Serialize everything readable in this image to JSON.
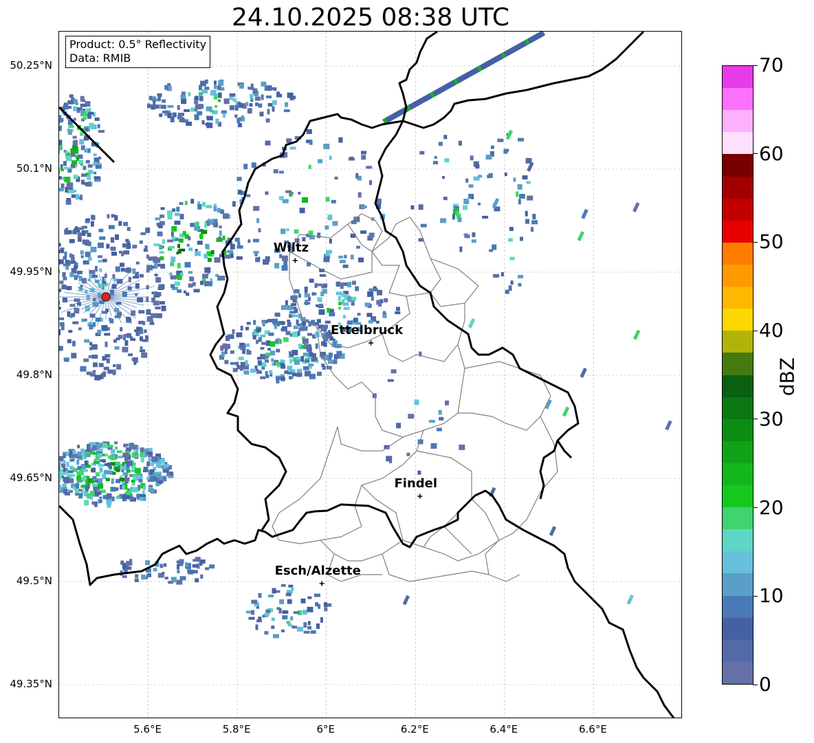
{
  "title": "24.10.2025 08:38 UTC",
  "info": {
    "product": "Product: 0.5° Reflectivity",
    "data": "Data: RMIB"
  },
  "lat_labels": [
    "50.25°N",
    "50.1°N",
    "49.95°N",
    "49.8°N",
    "49.65°N",
    "49.5°N",
    "49.35°N"
  ],
  "lat_values": [
    50.25,
    50.1,
    49.95,
    49.8,
    49.65,
    49.5,
    49.35
  ],
  "lon_labels": [
    "5.6°E",
    "5.8°E",
    "6°E",
    "6.2°E",
    "6.4°E",
    "6.6°E"
  ],
  "lon_values": [
    5.6,
    5.8,
    6.0,
    6.2,
    6.4,
    6.6
  ],
  "map_extent": {
    "lon_min": 5.4,
    "lon_max": 6.8,
    "lat_min": 49.3,
    "lat_max": 50.3
  },
  "cities": [
    {
      "name": "Wiltz",
      "lon": 5.93,
      "lat": 49.967
    },
    {
      "name": "Ettelbruck",
      "lon": 6.1,
      "lat": 49.847
    },
    {
      "name": "Findel",
      "lon": 6.21,
      "lat": 49.624
    },
    {
      "name": "Esch/Alzette",
      "lon": 5.99,
      "lat": 49.497
    }
  ],
  "radar_site": {
    "lon": 5.505,
    "lat": 49.914,
    "color": "#e8201a"
  },
  "colorbar": {
    "label": "dBZ",
    "ticks": [
      "0",
      "10",
      "20",
      "30",
      "40",
      "50",
      "60",
      "70"
    ],
    "tick_values": [
      0,
      10,
      20,
      30,
      40,
      50,
      60,
      70
    ],
    "min": 0,
    "max": 70,
    "step": 2.5,
    "colors": [
      "#6371a8",
      "#526aa5",
      "#4561a3",
      "#4a7ab5",
      "#5a9fc8",
      "#66c0dc",
      "#5fd6c5",
      "#3fd46d",
      "#15c81e",
      "#12b81a",
      "#10a317",
      "#0d8c13",
      "#0b7811",
      "#086010",
      "#447a10",
      "#b0b40a",
      "#fdd700",
      "#fdb800",
      "#fd9a00",
      "#fd7d00",
      "#e80000",
      "#c20000",
      "#a20000",
      "#7a0000",
      "#fee0fe",
      "#fdb0fd",
      "#fd6ffd",
      "#e93ae9"
    ]
  }
}
